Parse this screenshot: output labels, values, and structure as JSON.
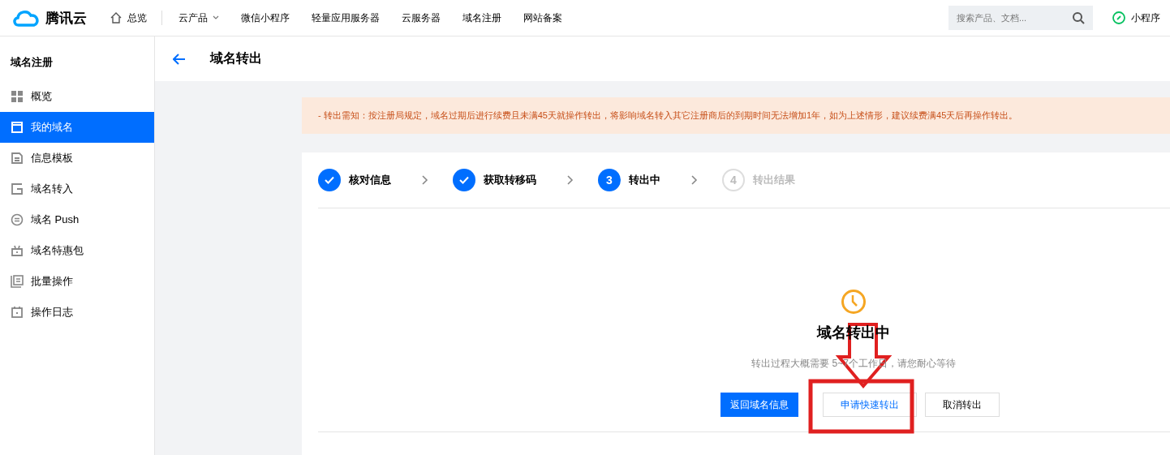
{
  "topbar": {
    "logo": "腾讯云",
    "home": "总览",
    "products": "云产品",
    "nav": [
      "微信小程序",
      "轻量应用服务器",
      "云服务器",
      "域名注册",
      "网站备案"
    ],
    "search": {
      "placeholder": "搜索产品、文档..."
    },
    "mini_program": "小程序"
  },
  "sidebar": {
    "title": "域名注册",
    "items": [
      {
        "label": "概览",
        "selected": false
      },
      {
        "label": "我的域名",
        "selected": true
      },
      {
        "label": "信息模板",
        "selected": false
      },
      {
        "label": "域名转入",
        "selected": false
      },
      {
        "label": "域名 Push",
        "selected": false
      },
      {
        "label": "域名特惠包",
        "selected": false
      },
      {
        "label": "批量操作",
        "selected": false
      },
      {
        "label": "操作日志",
        "selected": false
      }
    ]
  },
  "page": {
    "title": "域名转出"
  },
  "notice": "- 转出需知：按注册局规定，域名过期后进行续费且未满45天就操作转出，将影响域名转入其它注册商后的到期时间无法增加1年，如为上述情形，建议续费满45天后再操作转出。",
  "steps": [
    {
      "label": "核对信息",
      "kind": "done"
    },
    {
      "label": "获取转移码",
      "kind": "done"
    },
    {
      "number": "3",
      "label": "转出中",
      "kind": "current"
    },
    {
      "number": "4",
      "label": "转出结果",
      "kind": "pending"
    }
  ],
  "status": {
    "title": "域名转出中",
    "description": "转出过程大概需要 5~7个工作日，请您耐心等待",
    "buttons": [
      {
        "label": "返回域名信息",
        "kind": "primary"
      },
      {
        "label": "申请快速转出",
        "kind": "link"
      },
      {
        "label": "取消转出",
        "kind": "default"
      }
    ]
  }
}
